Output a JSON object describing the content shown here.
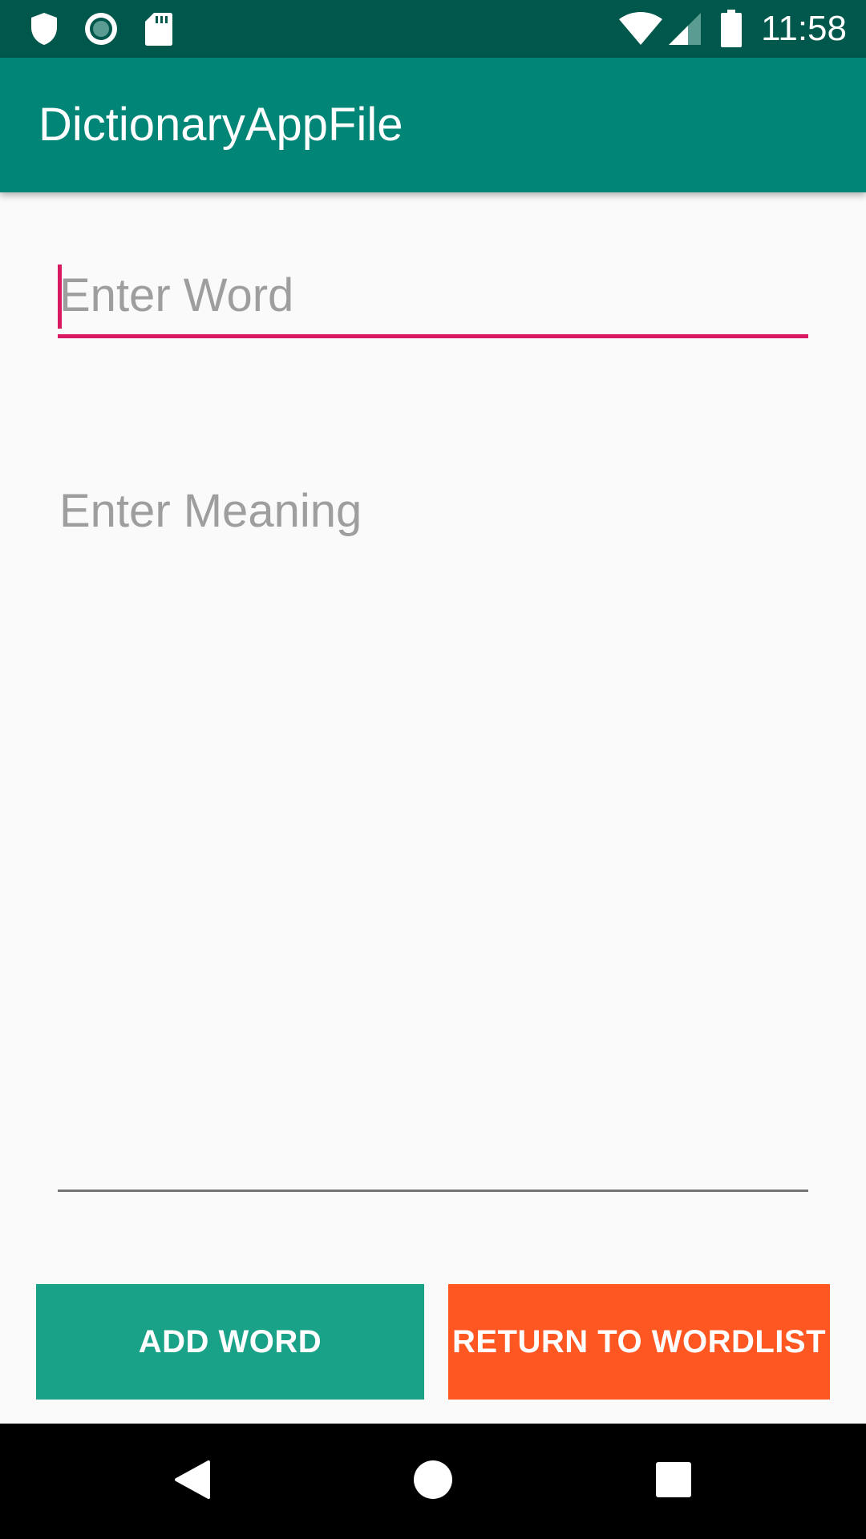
{
  "status_bar": {
    "time": "11:58",
    "left_icons": [
      "shield-icon",
      "record-icon",
      "sd-card-icon"
    ],
    "right_icons": [
      "wifi-icon",
      "cell-signal-icon",
      "battery-icon"
    ],
    "background": "#00574b"
  },
  "app_bar": {
    "title": "DictionaryAppFile",
    "background": "#008577"
  },
  "form": {
    "word_placeholder": "Enter Word",
    "word_value": "",
    "meaning_placeholder": "Enter Meaning",
    "meaning_value": "",
    "accent_color": "#d81b60"
  },
  "buttons": {
    "add_label": "ADD WORD",
    "add_color": "#19a287",
    "return_label": "RETURN TO WORDLIST",
    "return_color": "#ff5722"
  },
  "nav_bar": {
    "items": [
      "back-icon",
      "home-icon",
      "recents-icon"
    ]
  }
}
